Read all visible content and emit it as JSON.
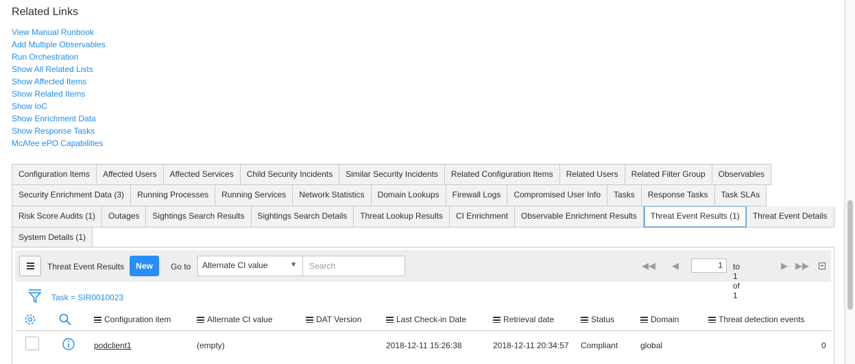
{
  "related_links": {
    "title": "Related Links",
    "links": [
      "View Manual Runbook",
      "Add Multiple Observables",
      "Run Orchestration",
      "Show All Related Lists",
      "Show Affected Items",
      "Show Related Items",
      "Show IoC",
      "Show Enrichment Data",
      "Show Response Tasks",
      "McAfee ePO Capabilities"
    ]
  },
  "tabs": {
    "row1": [
      "Configuration Items",
      "Affected Users",
      "Affected Services",
      "Child Security Incidents",
      "Similar Security Incidents",
      "Related Configuration Items",
      "Related Users",
      "Related Filter Group",
      "Observables"
    ],
    "row2": [
      "Security Enrichment Data (3)",
      "Running Processes",
      "Running Services",
      "Network Statistics",
      "Domain Lookups",
      "Firewall Logs",
      "Compromised User Info",
      "Tasks",
      "Response Tasks",
      "Task SLAs"
    ],
    "row3": [
      "Risk Score Audits (1)",
      "Outages",
      "Sightings Search Results",
      "Sightings Search Details",
      "Threat Lookup Results",
      "CI Enrichment",
      "Observable Enrichment Results",
      "Threat Event Results (1)",
      "Threat Event Details"
    ],
    "row4": [
      "System Details (1)"
    ],
    "active": "Threat Event Results (1)"
  },
  "list": {
    "title": "Threat Event Results",
    "new_label": "New",
    "goto_label": "Go to",
    "goto_selected": "Alternate CI value",
    "search_placeholder": "Search",
    "page_value": "1",
    "page_of": "to 1 of 1",
    "filter_text": "Task = SIR0010023",
    "columns": [
      "Configuration item",
      "Alternate CI value",
      "DAT Version",
      "Last Check-in Date",
      "Retrieval date",
      "Status",
      "Domain",
      "Threat detection events"
    ],
    "rows": [
      {
        "configuration_item": "podclient1",
        "alternate_ci_value": "(empty)",
        "dat_version": "",
        "last_check_in": "2018-12-11 15:26:38",
        "retrieval_date": "2018-12-11 20:34:57",
        "status": "Compliant",
        "domain": "global",
        "threat_detection_events": "0"
      }
    ]
  },
  "colors": {
    "link": "#1f8ceb",
    "primary_button": "#278efc",
    "active_tab_border": "#5b9ad5"
  }
}
